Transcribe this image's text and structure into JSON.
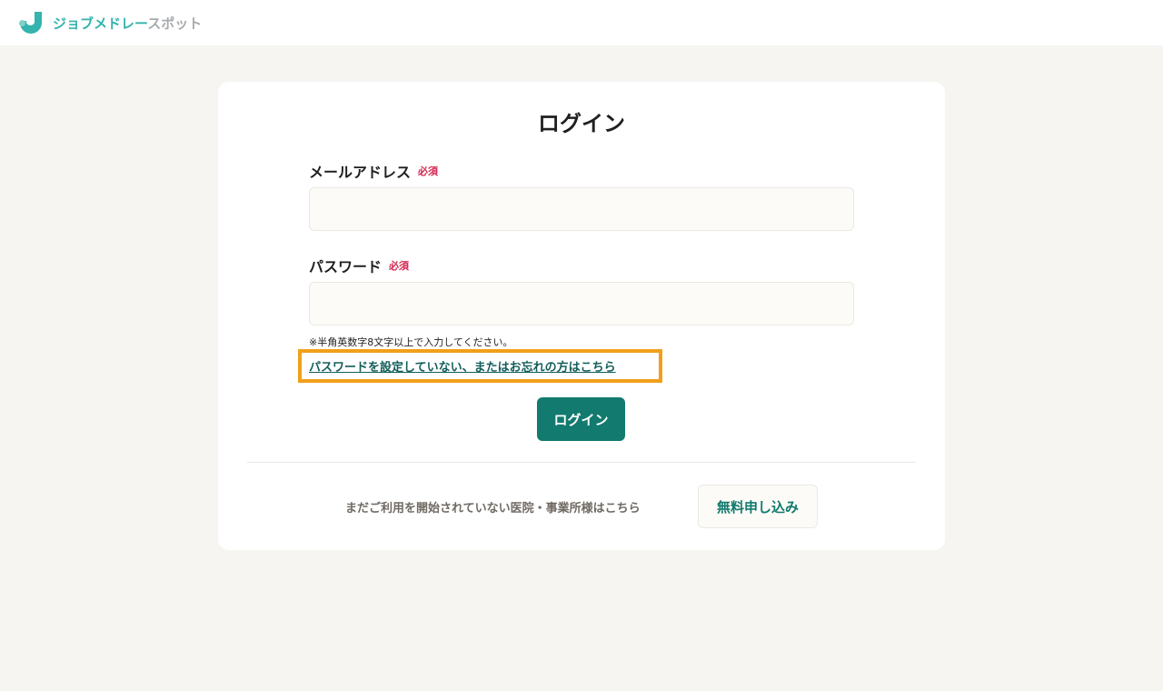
{
  "header": {
    "logo_text_primary": "ジョブメドレー",
    "logo_text_secondary": "スポット"
  },
  "login_form": {
    "title": "ログイン",
    "email": {
      "label": "メールアドレス",
      "required_badge": "必須",
      "value": "",
      "placeholder": ""
    },
    "password": {
      "label": "パスワード",
      "required_badge": "必須",
      "value": "",
      "placeholder": "",
      "hint": "※半角英数字8文字以上で入力してください。"
    },
    "forgot_link": "パスワードを設定していない、またはお忘れの方はこちら",
    "submit_label": "ログイン"
  },
  "signup": {
    "text": "まだご利用を開始されていない医院・事業所様はこちら",
    "button_label": "無料申し込み"
  },
  "colors": {
    "brand_teal": "#35b3ae",
    "primary_button": "#127a6e",
    "required": "#d6244e",
    "highlight_outline": "#f0a01a",
    "page_background": "#f6f5f2"
  }
}
